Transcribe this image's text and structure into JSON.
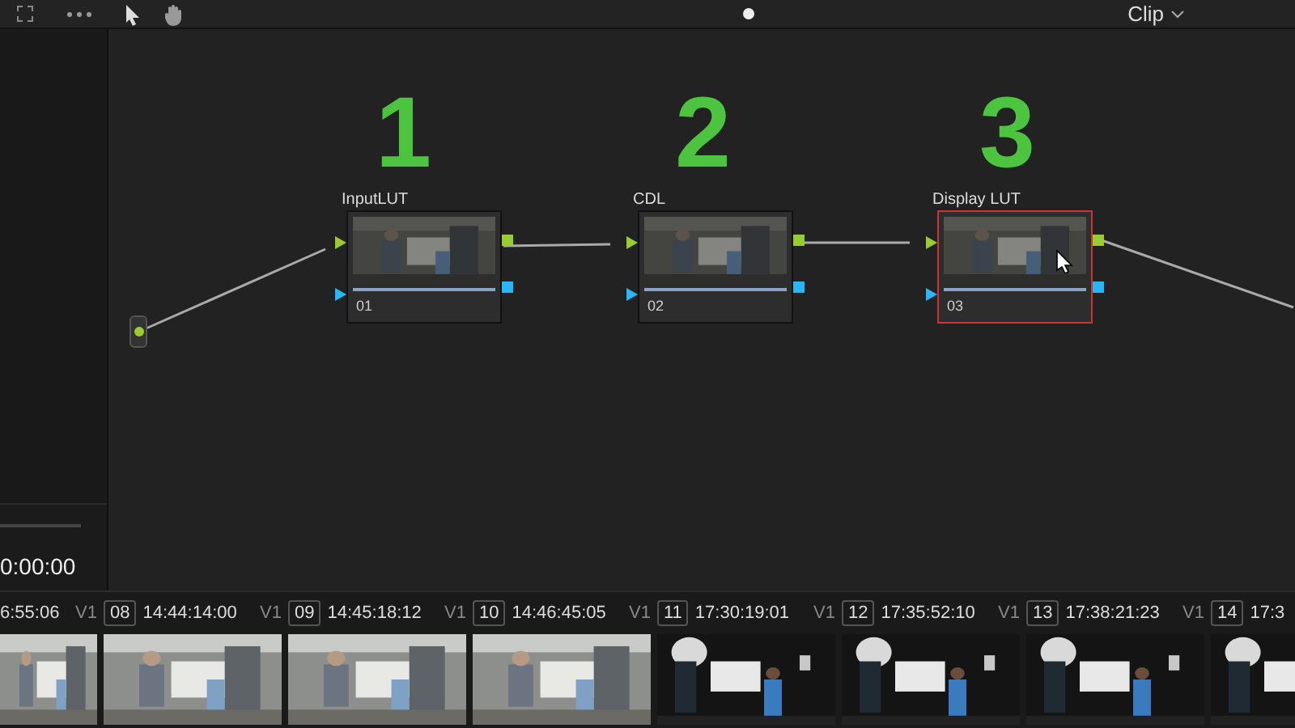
{
  "toolbar": {
    "mode_dropdown": {
      "label": "Clip"
    }
  },
  "viewer": {
    "timecode": "0:00:00"
  },
  "steps": [
    {
      "label": "1"
    },
    {
      "label": "2"
    },
    {
      "label": "3"
    }
  ],
  "nodes": [
    {
      "label": "InputLUT",
      "number": "01",
      "selected": false
    },
    {
      "label": "CDL",
      "number": "02",
      "selected": false
    },
    {
      "label": "Display LUT",
      "number": "03",
      "selected": true
    }
  ],
  "clips": [
    {
      "timecode": "6:55:06",
      "track": "V1"
    },
    {
      "number": "08",
      "timecode": "14:44:14:00",
      "track": "V1"
    },
    {
      "number": "09",
      "timecode": "14:45:18:12",
      "track": "V1"
    },
    {
      "number": "10",
      "timecode": "14:46:45:05",
      "track": "V1"
    },
    {
      "number": "11",
      "timecode": "17:30:19:01",
      "track": "V1"
    },
    {
      "number": "12",
      "timecode": "17:35:52:10",
      "track": "V1"
    },
    {
      "number": "13",
      "timecode": "17:38:21:23",
      "track": "V1"
    },
    {
      "number": "14",
      "timecode": "17:3"
    }
  ]
}
